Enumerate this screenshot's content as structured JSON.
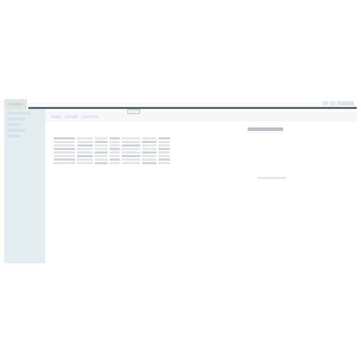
{
  "window": {
    "app_title": "",
    "accent_color": "#5a6b76",
    "sidebar_color": "#e5edf0"
  },
  "topbar": {
    "tools": [
      "settings-icon",
      "help-icon"
    ],
    "user_label": ""
  },
  "sidebar": {
    "items": [
      {
        "label": ""
      },
      {
        "label": ""
      },
      {
        "label": ""
      },
      {
        "label": ""
      },
      {
        "label": ""
      }
    ]
  },
  "main": {
    "tabs": [
      {
        "label": ""
      },
      {
        "label": ""
      },
      {
        "label": ""
      }
    ],
    "active_tab_label": "",
    "action_button_label": "",
    "footer_text": ""
  },
  "table": {
    "rows": 8,
    "columns": 7
  }
}
